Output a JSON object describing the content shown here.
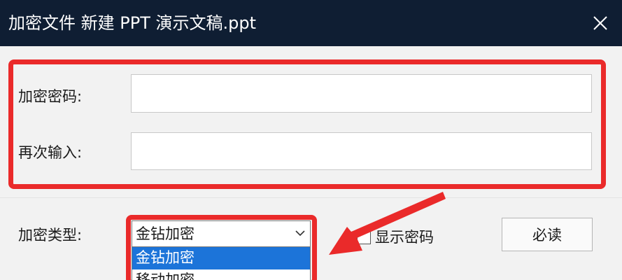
{
  "window": {
    "title": "加密文件  新建 PPT 演示文稿.ppt",
    "close_icon": "close-icon"
  },
  "form": {
    "password_label": "加密密码:",
    "password_value": "",
    "confirm_label": "再次输入:",
    "confirm_value": "",
    "type_label": "加密类型:",
    "type_selected": "金钻加密",
    "type_options": [
      "金钻加密",
      "移动加密"
    ],
    "show_password_label": "显示密码",
    "show_password_checked": false,
    "must_read_button": "必读"
  },
  "annotations": {
    "highlight_color": "#ea2a2a",
    "arrow_icon": "red-arrow-annotation"
  },
  "colors": {
    "titlebar": "#0f1e33",
    "selection": "#1c74d9"
  }
}
